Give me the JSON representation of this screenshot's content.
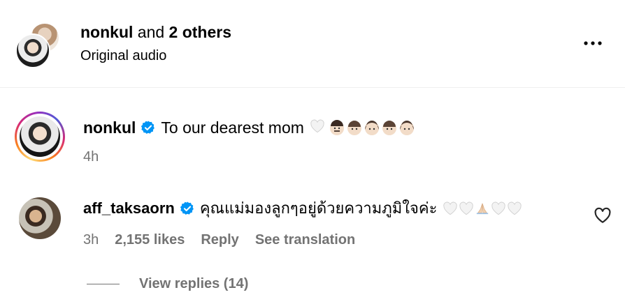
{
  "header": {
    "user": "nonkul",
    "connector": "and",
    "others": "2 others",
    "audio": "Original audio"
  },
  "caption": {
    "username": "nonkul",
    "text": "To our dearest mom",
    "time": "4h"
  },
  "comment": {
    "username": "aff_taksaorn",
    "text": "คุณแม่มองลูกๆอยู่ด้วยความภูมิใจค่ะ",
    "time": "3h",
    "likes": "2,155 likes",
    "reply_label": "Reply",
    "translate_label": "See translation"
  },
  "replies": {
    "label": "View replies (14)"
  },
  "colors": {
    "verified": "#0095f6",
    "secondary_text": "#737373",
    "divider": "#efefef"
  },
  "icons": {
    "more": "more-horizontal-icon",
    "verified": "verified-badge-icon",
    "like": "heart-outline-icon"
  }
}
